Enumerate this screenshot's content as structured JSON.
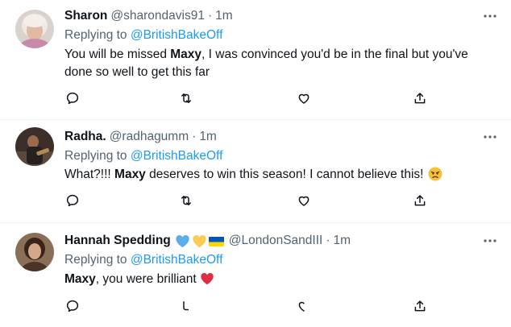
{
  "tweets": [
    {
      "name": "Sharon",
      "handle": "@sharondavis91",
      "dot": "·",
      "time": "1m",
      "replying_prefix": "Replying to ",
      "replying_to": "@BritishBakeOff",
      "text_1": "You will be missed ",
      "text_bold": "Maxy",
      "text_2": ", I was convinced you'd be in the final but you've done so well to get this far"
    },
    {
      "name": "Radha.",
      "handle": "@radhagumm",
      "dot": "·",
      "time": "1m",
      "replying_prefix": "Replying to ",
      "replying_to": "@BritishBakeOff",
      "text_1": "What?!!! ",
      "text_bold": "Maxy",
      "text_2": " deserves to win this season! I cannot believe this!",
      "emoji": "pouting-face-icon"
    },
    {
      "name": "Hannah Spedding",
      "handle": "@LondonSandIII",
      "dot": "·",
      "time": "1m",
      "replying_prefix": "Replying to ",
      "replying_to": "@BritishBakeOff",
      "text_bold": "Maxy",
      "text_2": ", you were brilliant",
      "name_emojis": [
        "blue-heart-icon",
        "yellow-heart-icon",
        "ukraine-flag-icon"
      ],
      "text_emoji": "red-heart-icon"
    }
  ],
  "actions": [
    "reply-icon",
    "retweet-icon",
    "like-icon",
    "share-icon"
  ],
  "colors": {
    "accent": "#1d9bf0",
    "secondary_text": "#536471",
    "divider": "#eff3f4"
  }
}
